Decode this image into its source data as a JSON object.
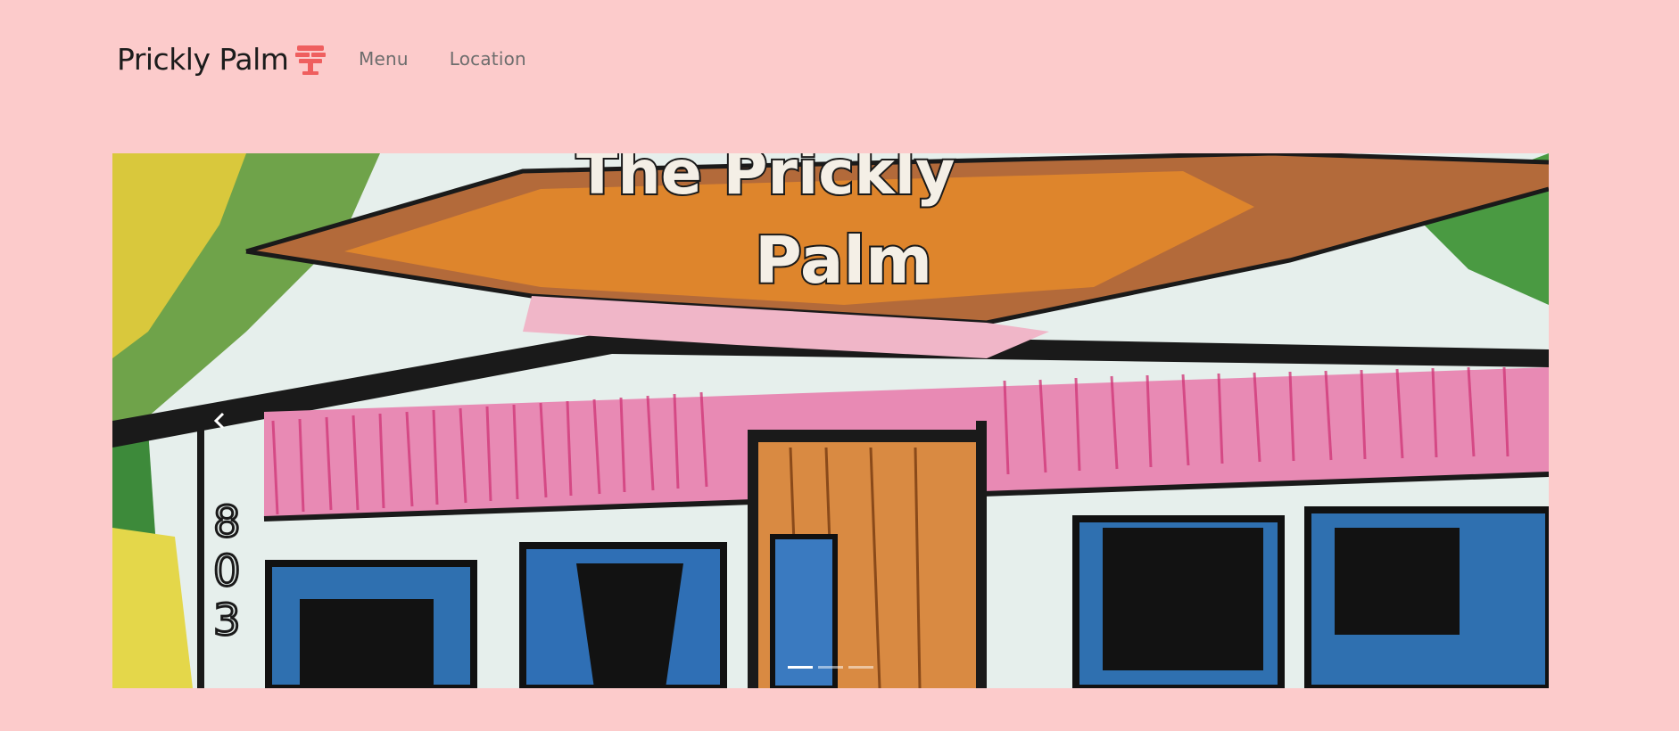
{
  "brand": {
    "name": "Prickly Palm",
    "icon": "palm-cocktail-icon",
    "accent": "#ef5f5f"
  },
  "nav": {
    "items": [
      {
        "label": "Menu"
      },
      {
        "label": "Location"
      }
    ]
  },
  "carousel": {
    "slides": [
      {
        "image": "sketch-storefront-image"
      },
      {
        "image": "slide-2-image"
      },
      {
        "image": "slide-3-image"
      }
    ],
    "active_index": 0,
    "prev_icon": "chevron-left-icon",
    "next_icon": "chevron-right-icon",
    "sign_line1": "The Prickly",
    "sign_line2": "Palm",
    "address_digits": [
      "8",
      "0",
      "3"
    ]
  },
  "colors": {
    "background": "#fccbcb",
    "brand_text": "#1c1c1c",
    "nav_text": "#6d6d6d"
  }
}
